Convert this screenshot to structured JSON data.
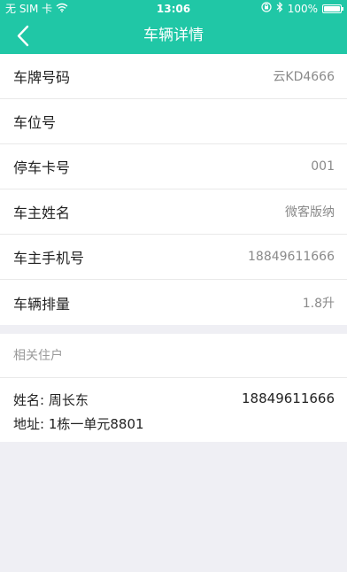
{
  "status_bar": {
    "carrier": "无 SIM 卡",
    "time": "13:06",
    "battery_text": "100%",
    "icons": [
      "wifi-icon",
      "orientation-lock-icon",
      "bluetooth-icon",
      "battery-icon"
    ]
  },
  "nav": {
    "title": "车辆详情",
    "back_icon": "chevron-left-icon"
  },
  "details": [
    {
      "label": "车牌号码",
      "value": "云KD4666"
    },
    {
      "label": "车位号",
      "value": ""
    },
    {
      "label": "停车卡号",
      "value": "001"
    },
    {
      "label": "车主姓名",
      "value": "微客版纳"
    },
    {
      "label": "车主手机号",
      "value": "18849611666"
    },
    {
      "label": "车辆排量",
      "value": "1.8升"
    }
  ],
  "related": {
    "header": "相关住户",
    "resident": {
      "name_line": "姓名: 周长东",
      "phone": "18849611666",
      "address_line": "地址: 1栋一单元8801"
    }
  },
  "colors": {
    "header_bg": "#20c7a6",
    "page_bg": "#efeff4"
  }
}
